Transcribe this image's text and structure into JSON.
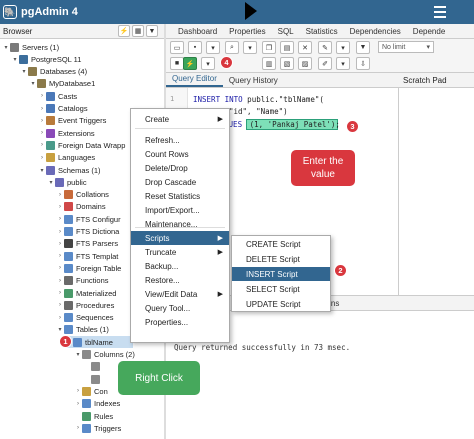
{
  "app": {
    "title": "pgAdmin 4",
    "logo_glyph": "🐘"
  },
  "browser": {
    "label": "Browser",
    "tree": [
      {
        "label": "Servers (1)",
        "depth": 0,
        "toggle": "▾",
        "color": "#7a7a7a"
      },
      {
        "label": "PostgreSQL 11",
        "depth": 1,
        "toggle": "▾",
        "color": "#3c6e9c"
      },
      {
        "label": "Databases (4)",
        "depth": 2,
        "toggle": "▾",
        "color": "#8b7a4a"
      },
      {
        "label": "MyDatabase1",
        "depth": 3,
        "toggle": "▾",
        "color": "#8b7a4a"
      },
      {
        "label": "Casts",
        "depth": 4,
        "toggle": "›",
        "color": "#4a78b8"
      },
      {
        "label": "Catalogs",
        "depth": 4,
        "toggle": "›",
        "color": "#4a78b8"
      },
      {
        "label": "Event Triggers",
        "depth": 4,
        "toggle": "›",
        "color": "#b87a3a"
      },
      {
        "label": "Extensions",
        "depth": 4,
        "toggle": "›",
        "color": "#8a4ab8"
      },
      {
        "label": "Foreign Data Wrapp",
        "depth": 4,
        "toggle": "›",
        "color": "#4a9a8a"
      },
      {
        "label": "Languages",
        "depth": 4,
        "toggle": "›",
        "color": "#c8a040"
      },
      {
        "label": "Schemas (1)",
        "depth": 4,
        "toggle": "▾",
        "color": "#6a6ab8"
      },
      {
        "label": "public",
        "depth": 5,
        "toggle": "▾",
        "color": "#6a6ab8"
      },
      {
        "label": "Collations",
        "depth": 6,
        "toggle": "›",
        "color": "#c86a3a"
      },
      {
        "label": "Domains",
        "depth": 6,
        "toggle": "›",
        "color": "#d04848"
      },
      {
        "label": "FTS Configur",
        "depth": 6,
        "toggle": "›",
        "color": "#5a8ac8"
      },
      {
        "label": "FTS Dictiona",
        "depth": 6,
        "toggle": "›",
        "color": "#5a8ac8"
      },
      {
        "label": "FTS Parsers",
        "depth": 6,
        "toggle": "›",
        "color": "#444444"
      },
      {
        "label": "FTS Templat",
        "depth": 6,
        "toggle": "›",
        "color": "#5a8ac8"
      },
      {
        "label": "Foreign Table",
        "depth": 6,
        "toggle": "›",
        "color": "#5a8ac8"
      },
      {
        "label": "Functions",
        "depth": 6,
        "toggle": "›",
        "color": "#6a6a6a"
      },
      {
        "label": "Materialized",
        "depth": 6,
        "toggle": "›",
        "color": "#4a9a6a"
      },
      {
        "label": "Procedures",
        "depth": 6,
        "toggle": "›",
        "color": "#6a6a6a"
      },
      {
        "label": "Sequences",
        "depth": 6,
        "toggle": "›",
        "color": "#5a8ac8"
      },
      {
        "label": "Tables (1)",
        "depth": 6,
        "toggle": "▾",
        "color": "#5a8ac8"
      },
      {
        "label": "tblName",
        "depth": 7,
        "toggle": "▾",
        "color": "#5a8ac8",
        "selected": true
      },
      {
        "label": "Columns (2)",
        "depth": 8,
        "toggle": "▾",
        "color": "#8a8a8a"
      },
      {
        "label": "",
        "depth": 9,
        "toggle": "",
        "color": "#8a8a8a"
      },
      {
        "label": "",
        "depth": 9,
        "toggle": "",
        "color": "#8a8a8a"
      },
      {
        "label": "Con",
        "depth": 8,
        "toggle": "›",
        "color": "#c8a040"
      },
      {
        "label": "Indexes",
        "depth": 8,
        "toggle": "›",
        "color": "#5a8ac8"
      },
      {
        "label": "Rules",
        "depth": 8,
        "toggle": "",
        "color": "#4a9a6a"
      },
      {
        "label": "Triggers",
        "depth": 8,
        "toggle": "›",
        "color": "#5a8ac8"
      }
    ]
  },
  "tabs": [
    "Dashboard",
    "Properties",
    "SQL",
    "Statistics",
    "Dependencies",
    "Depende"
  ],
  "query": {
    "limit_placeholder": "No limit",
    "editor_tabs": [
      "Query Editor",
      "Query History"
    ],
    "scratch_pad": "Scratch Pad",
    "line1_no": "1",
    "line1_kw": "INSERT INTO",
    "line1_rest": " public.\"tblName\"(",
    "line2": "\"id\", \"Name\")",
    "line3_kw": "VALUES",
    "line3_vals": "(1, 'Pankaj Patel');",
    "bottom_tab_tail": "ations",
    "result": "Query returned successfully in 73 msec."
  },
  "context_menu": {
    "items": [
      "Create",
      "Refresh...",
      "Count Rows",
      "Delete/Drop",
      "Drop Cascade",
      "Reset Statistics",
      "Import/Export...",
      "Maintenance...",
      "Scripts",
      "Truncate",
      "Backup...",
      "Restore...",
      "View/Edit Data",
      "Query Tool...",
      "Properties..."
    ]
  },
  "scripts_menu": {
    "items": [
      "CREATE Script",
      "DELETE Script",
      "INSERT Script",
      "SELECT Script",
      "UPDATE Script"
    ]
  },
  "annotations": {
    "badge1": "1",
    "badge2": "2",
    "badge3": "3",
    "badge4": "4",
    "enter_value": "Enter the value",
    "right_click": "Right Click",
    "accent_red": "#d9373e",
    "accent_green": "#46a85c"
  }
}
